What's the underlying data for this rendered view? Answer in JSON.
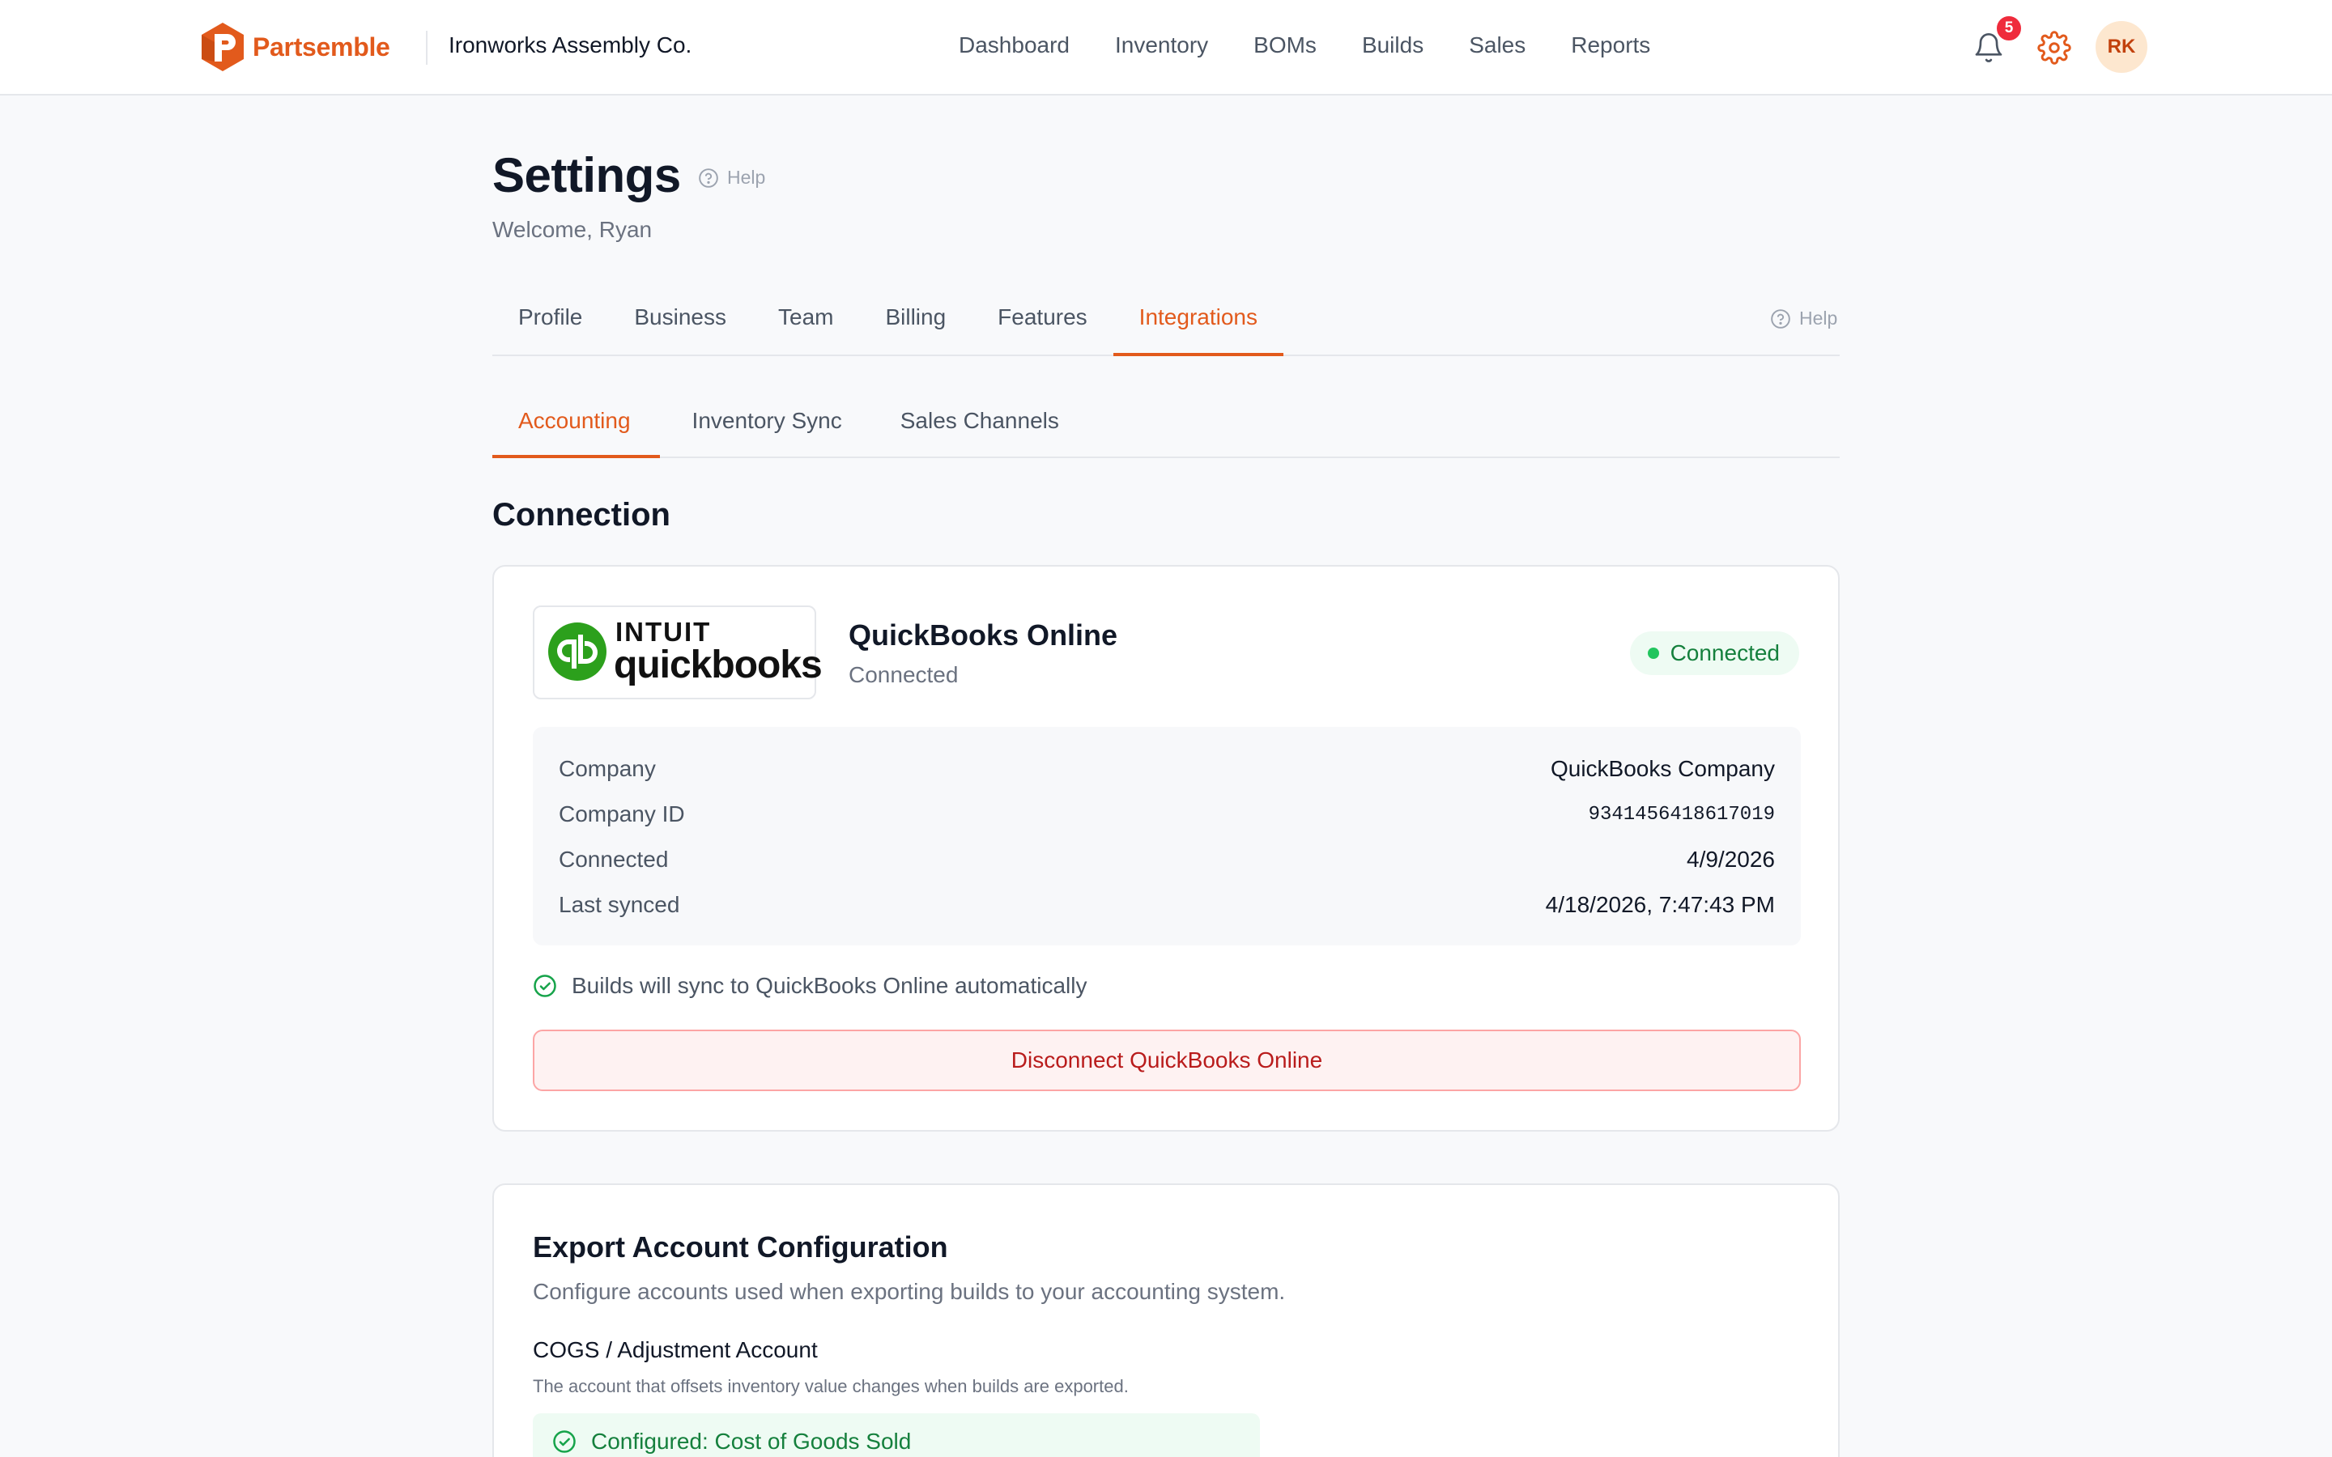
{
  "topbar": {
    "brand_name": "Partsemble",
    "company_name": "Ironworks Assembly Co.",
    "nav": [
      "Dashboard",
      "Inventory",
      "BOMs",
      "Builds",
      "Sales",
      "Reports"
    ],
    "notification_count": "5",
    "avatar_initials": "RK"
  },
  "page": {
    "title": "Settings",
    "help_label": "Help",
    "welcome": "Welcome, Ryan"
  },
  "tabs": {
    "primary": [
      "Profile",
      "Business",
      "Team",
      "Billing",
      "Features",
      "Integrations"
    ],
    "primary_active": "Integrations",
    "help_label": "Help",
    "secondary": [
      "Accounting",
      "Inventory Sync",
      "Sales Channels"
    ],
    "secondary_active": "Accounting"
  },
  "connection": {
    "section_title": "Connection",
    "logo_top": "INTUIT",
    "logo_word": "quickbooks",
    "provider_name": "QuickBooks Online",
    "provider_status": "Connected",
    "status_pill": "Connected",
    "details": [
      {
        "label": "Company",
        "value": "QuickBooks Company"
      },
      {
        "label": "Company ID",
        "value": "9341456418617019"
      },
      {
        "label": "Connected",
        "value": "4/9/2026"
      },
      {
        "label": "Last synced",
        "value": "4/18/2026, 7:47:43 PM"
      }
    ],
    "sync_note": "Builds will sync to QuickBooks Online automatically",
    "disconnect_label": "Disconnect QuickBooks Online"
  },
  "export": {
    "title": "Export Account Configuration",
    "description": "Configure accounts used when exporting builds to your accounting system.",
    "cogs_label": "COGS / Adjustment Account",
    "cogs_help": "The account that offsets inventory value changes when builds are exported.",
    "configured_text": "Configured: Cost of Goods Sold"
  },
  "colors": {
    "accent": "#e25a1c",
    "success": "#15803d",
    "danger": "#b91c1c",
    "qb_green": "#2ca01c"
  }
}
